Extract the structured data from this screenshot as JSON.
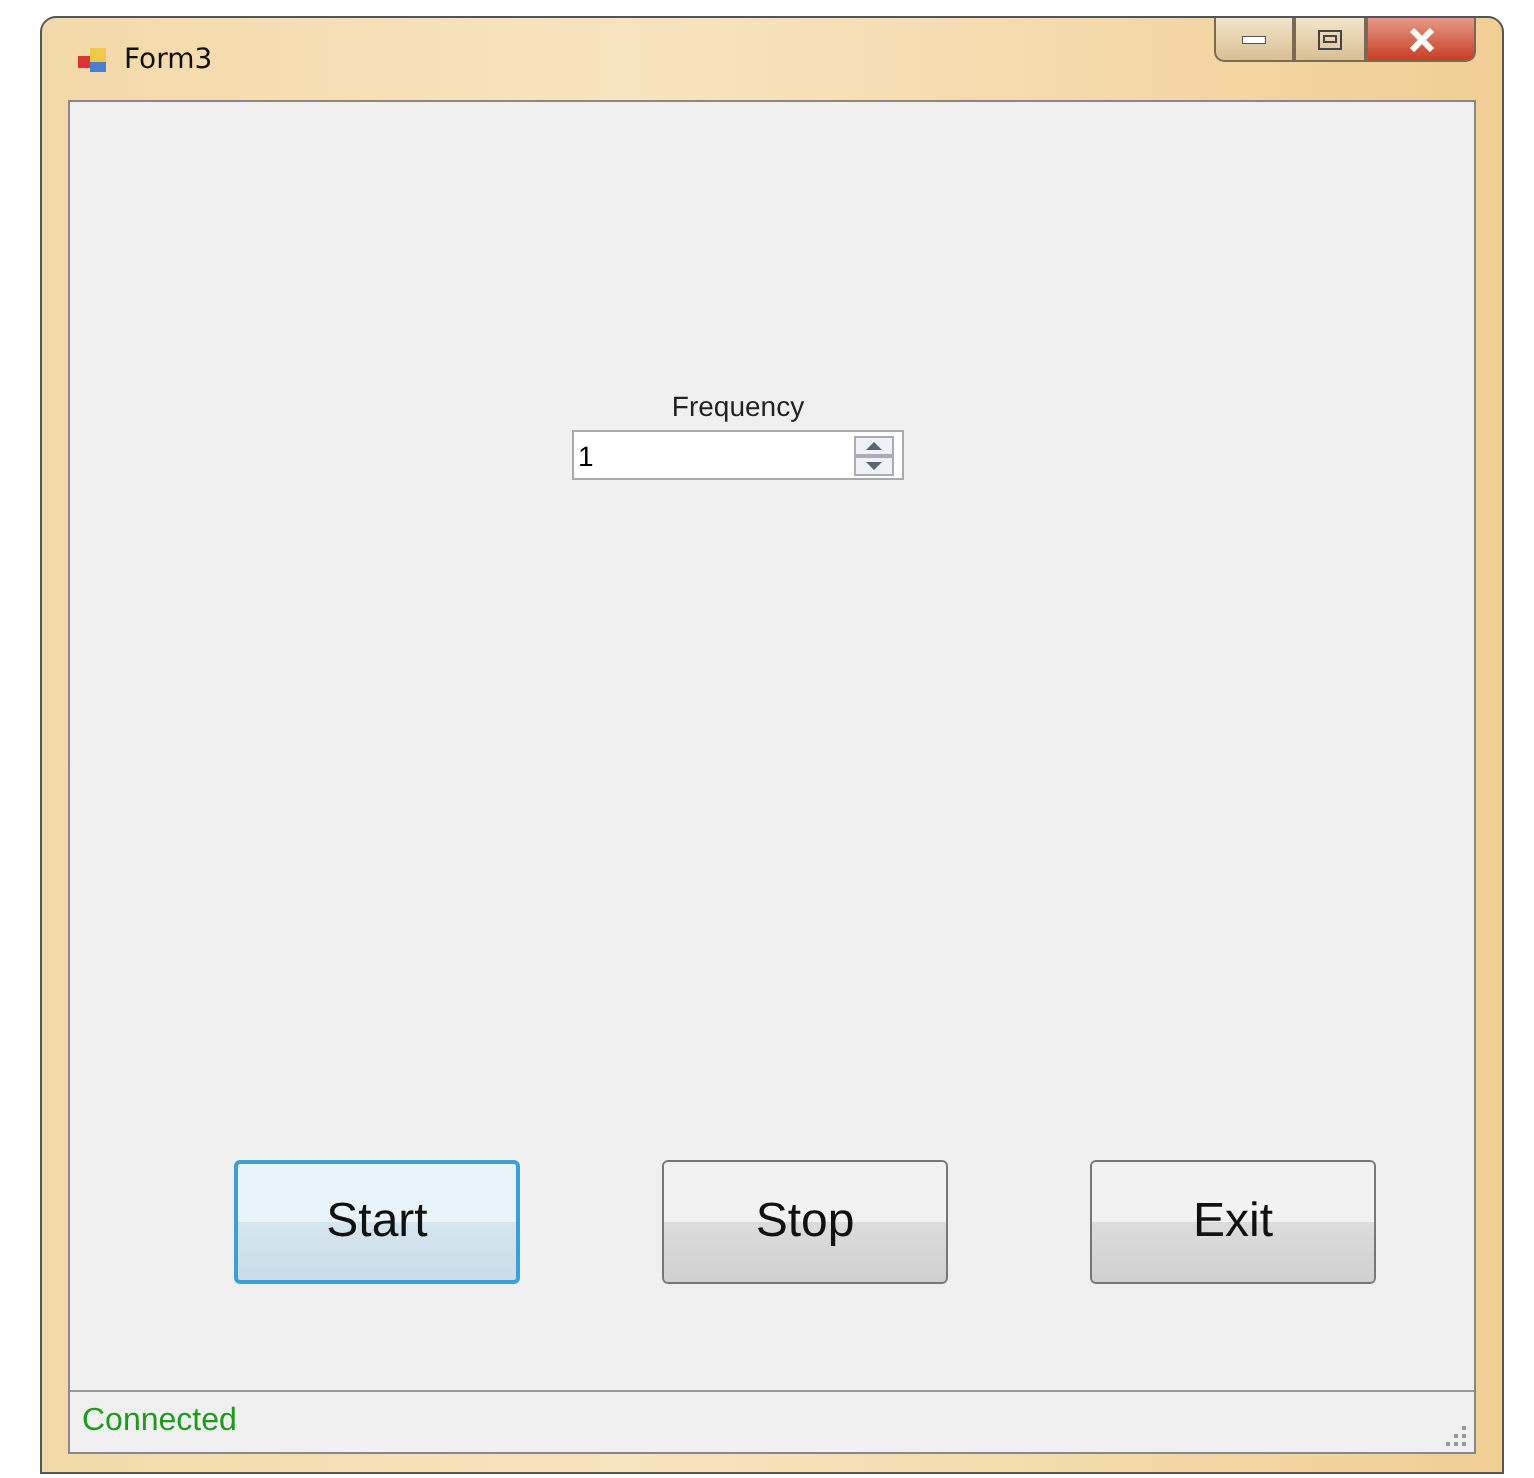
{
  "window": {
    "title": "Form3"
  },
  "frequency": {
    "label": "Frequency",
    "value": "1"
  },
  "buttons": [
    {
      "label": "Start",
      "focused": true
    },
    {
      "label": "Stop",
      "focused": false
    },
    {
      "label": "Exit",
      "focused": false
    }
  ],
  "status_bar": {
    "text": "Connected"
  }
}
